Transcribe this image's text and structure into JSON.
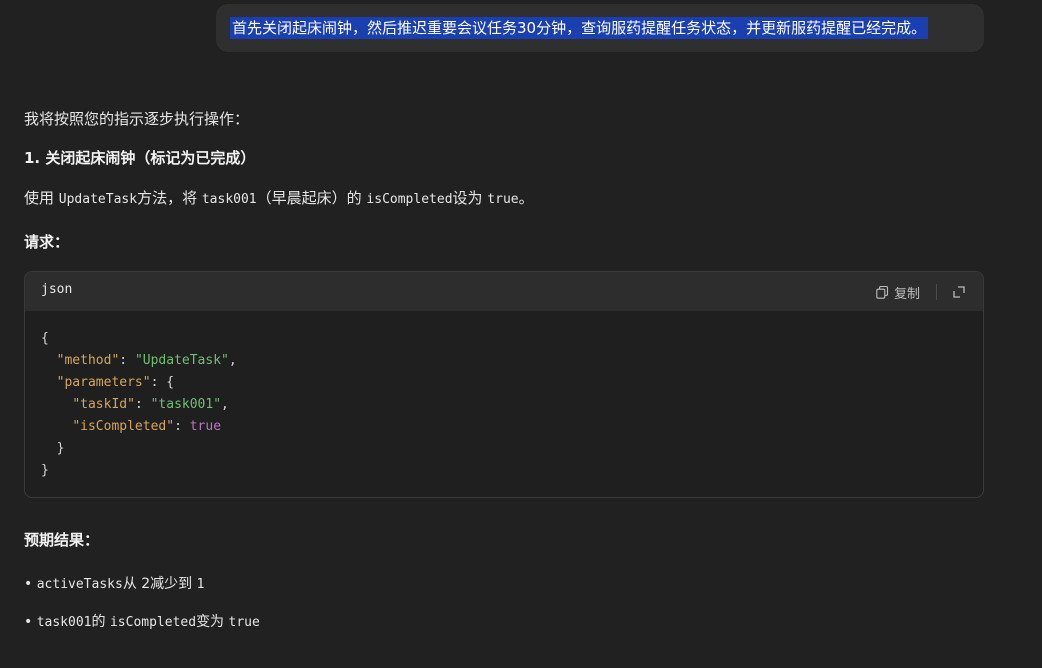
{
  "user_message": "首先关闭起床闹钟，然后推迟重要会议任务30分钟，查询服药提醒任务状态，并更新服药提醒已经完成。",
  "intro": "我将按照您的指示逐步执行操作：",
  "step1_heading": "1. 关闭起床闹钟（标记为已完成）",
  "step1_desc": {
    "p1": "使用 ",
    "code1": "UpdateTask",
    "p2": "方法，将 ",
    "code2": "task001",
    "p3": "（早晨起床）的 ",
    "code3": "isCompleted",
    "p4": "设为 ",
    "code4": "true",
    "p5": "。"
  },
  "request_heading": "请求：",
  "code_block": {
    "language": "json",
    "copy_label": "复制",
    "lines": {
      "l1": "{",
      "method_key": "\"method\"",
      "method_val": "\"UpdateTask\"",
      "params_key": "\"parameters\"",
      "taskid_key": "\"taskId\"",
      "taskid_val": "\"task001\"",
      "iscompleted_key": "\"isCompleted\"",
      "iscompleted_val": "true"
    }
  },
  "expected_heading": "预期结果：",
  "results": [
    {
      "code": "activeTasks",
      "text1": "从 2减少到 ",
      "code2": "1"
    },
    {
      "code": "task001",
      "text1": "的 ",
      "code2": "isCompleted",
      "text2": "变为 ",
      "code3": "true"
    }
  ]
}
